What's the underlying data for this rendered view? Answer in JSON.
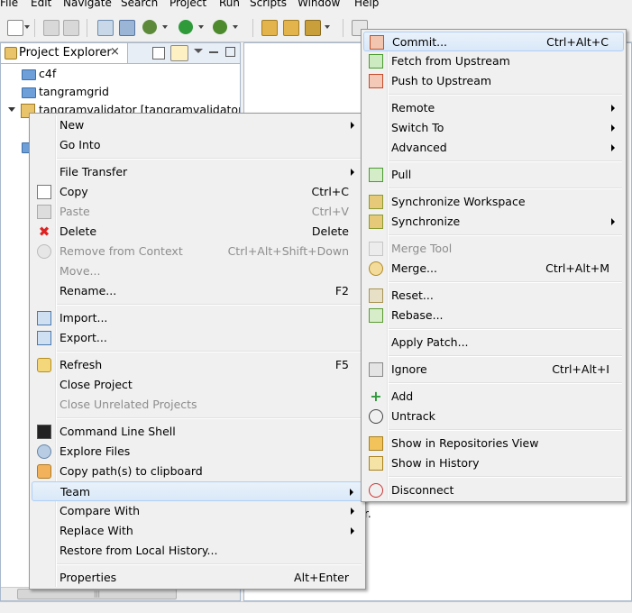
{
  "menubar": {
    "items": [
      "File",
      "Edit",
      "Navigate",
      "Search",
      "Project",
      "Run",
      "Scripts",
      "Window",
      "Help"
    ]
  },
  "explorer": {
    "tab_label": "Project Explorer",
    "close_glyph": "×",
    "tree": [
      {
        "label": "c4f",
        "icon": "folder-icon"
      },
      {
        "label": "tangramgrid",
        "icon": "folder-icon"
      },
      {
        "label": "tangramvalidator [tangramvalidator m",
        "icon": "git-project-icon"
      }
    ],
    "scroll_glyph": "|||"
  },
  "editor": {
    "fragment": "r."
  },
  "context_menu": {
    "items": [
      {
        "label": "New",
        "shortcut": "",
        "submenu": true,
        "disabled": false,
        "icon": ""
      },
      {
        "label": "Go Into",
        "shortcut": "",
        "submenu": false,
        "disabled": false,
        "icon": ""
      },
      {
        "sep": true
      },
      {
        "label": "File Transfer",
        "shortcut": "",
        "submenu": true,
        "disabled": false,
        "icon": ""
      },
      {
        "label": "Copy",
        "shortcut": "Ctrl+C",
        "submenu": false,
        "disabled": false,
        "icon": "copy-icon"
      },
      {
        "label": "Paste",
        "shortcut": "Ctrl+V",
        "submenu": false,
        "disabled": true,
        "icon": "paste-icon"
      },
      {
        "label": "Delete",
        "shortcut": "Delete",
        "submenu": false,
        "disabled": false,
        "icon": "delete-icon"
      },
      {
        "label": "Remove from Context",
        "shortcut": "Ctrl+Alt+Shift+Down",
        "submenu": false,
        "disabled": true,
        "icon": "remove-context-icon"
      },
      {
        "label": "Move...",
        "shortcut": "",
        "submenu": false,
        "disabled": true,
        "icon": ""
      },
      {
        "label": "Rename...",
        "shortcut": "F2",
        "submenu": false,
        "disabled": false,
        "icon": ""
      },
      {
        "sep": true
      },
      {
        "label": "Import...",
        "shortcut": "",
        "submenu": false,
        "disabled": false,
        "icon": "import-icon"
      },
      {
        "label": "Export...",
        "shortcut": "",
        "submenu": false,
        "disabled": false,
        "icon": "export-icon"
      },
      {
        "sep": true
      },
      {
        "label": "Refresh",
        "shortcut": "F5",
        "submenu": false,
        "disabled": false,
        "icon": "refresh-icon"
      },
      {
        "label": "Close Project",
        "shortcut": "",
        "submenu": false,
        "disabled": false,
        "icon": ""
      },
      {
        "label": "Close Unrelated Projects",
        "shortcut": "",
        "submenu": false,
        "disabled": true,
        "icon": ""
      },
      {
        "sep": true
      },
      {
        "label": "Command Line Shell",
        "shortcut": "",
        "submenu": false,
        "disabled": false,
        "icon": "terminal-icon"
      },
      {
        "label": "Explore Files",
        "shortcut": "",
        "submenu": false,
        "disabled": false,
        "icon": "explore-icon"
      },
      {
        "label": "Copy path(s) to clipboard",
        "shortcut": "",
        "submenu": false,
        "disabled": false,
        "icon": "clipboard-icon"
      },
      {
        "label": "Team",
        "shortcut": "",
        "submenu": true,
        "disabled": false,
        "icon": "",
        "highlighted": true
      },
      {
        "label": "Compare With",
        "shortcut": "",
        "submenu": true,
        "disabled": false,
        "icon": ""
      },
      {
        "label": "Replace With",
        "shortcut": "",
        "submenu": true,
        "disabled": false,
        "icon": ""
      },
      {
        "label": "Restore from Local History...",
        "shortcut": "",
        "submenu": false,
        "disabled": false,
        "icon": ""
      },
      {
        "sep": true
      },
      {
        "label": "Properties",
        "shortcut": "Alt+Enter",
        "submenu": false,
        "disabled": false,
        "icon": ""
      }
    ]
  },
  "team_menu": {
    "items": [
      {
        "label": "Commit...",
        "shortcut": "Ctrl+Alt+C",
        "submenu": false,
        "disabled": false,
        "icon": "commit-icon",
        "highlighted": true
      },
      {
        "label": "Fetch from Upstream",
        "shortcut": "",
        "submenu": false,
        "disabled": false,
        "icon": "fetch-icon"
      },
      {
        "label": "Push to Upstream",
        "shortcut": "",
        "submenu": false,
        "disabled": false,
        "icon": "push-icon"
      },
      {
        "sep": true
      },
      {
        "label": "Remote",
        "shortcut": "",
        "submenu": true,
        "disabled": false,
        "icon": ""
      },
      {
        "label": "Switch To",
        "shortcut": "",
        "submenu": true,
        "disabled": false,
        "icon": ""
      },
      {
        "label": "Advanced",
        "shortcut": "",
        "submenu": true,
        "disabled": false,
        "icon": ""
      },
      {
        "sep": true
      },
      {
        "label": "Pull",
        "shortcut": "",
        "submenu": false,
        "disabled": false,
        "icon": "pull-icon"
      },
      {
        "sep": true
      },
      {
        "label": "Synchronize Workspace",
        "shortcut": "",
        "submenu": false,
        "disabled": false,
        "icon": "sync-workspace-icon"
      },
      {
        "label": "Synchronize",
        "shortcut": "",
        "submenu": true,
        "disabled": false,
        "icon": "synchronize-icon"
      },
      {
        "sep": true
      },
      {
        "label": "Merge Tool",
        "shortcut": "",
        "submenu": false,
        "disabled": true,
        "icon": "merge-tool-icon"
      },
      {
        "label": "Merge...",
        "shortcut": "Ctrl+Alt+M",
        "submenu": false,
        "disabled": false,
        "icon": "merge-icon"
      },
      {
        "sep": true
      },
      {
        "label": "Reset...",
        "shortcut": "",
        "submenu": false,
        "disabled": false,
        "icon": "reset-icon"
      },
      {
        "label": "Rebase...",
        "shortcut": "",
        "submenu": false,
        "disabled": false,
        "icon": "rebase-icon"
      },
      {
        "sep": true
      },
      {
        "label": "Apply Patch...",
        "shortcut": "",
        "submenu": false,
        "disabled": false,
        "icon": ""
      },
      {
        "sep": true
      },
      {
        "label": "Ignore",
        "shortcut": "Ctrl+Alt+I",
        "submenu": false,
        "disabled": false,
        "icon": "ignore-icon"
      },
      {
        "sep": true
      },
      {
        "label": "Add",
        "shortcut": "",
        "submenu": false,
        "disabled": false,
        "icon": "add-icon"
      },
      {
        "label": "Untrack",
        "shortcut": "",
        "submenu": false,
        "disabled": false,
        "icon": "untrack-icon"
      },
      {
        "sep": true
      },
      {
        "label": "Show in Repositories View",
        "shortcut": "",
        "submenu": false,
        "disabled": false,
        "icon": "repositories-icon"
      },
      {
        "label": "Show in History",
        "shortcut": "",
        "submenu": false,
        "disabled": false,
        "icon": "history-icon"
      },
      {
        "sep": true
      },
      {
        "label": "Disconnect",
        "shortcut": "",
        "submenu": false,
        "disabled": false,
        "icon": "disconnect-icon"
      }
    ]
  },
  "colors": {
    "highlight_border": "#aecff7",
    "highlight_bg": "#d9e8f8",
    "disabled_text": "#8d8d8d",
    "menu_bg": "#f0f0f0",
    "view_border": "#a9b8cc"
  }
}
